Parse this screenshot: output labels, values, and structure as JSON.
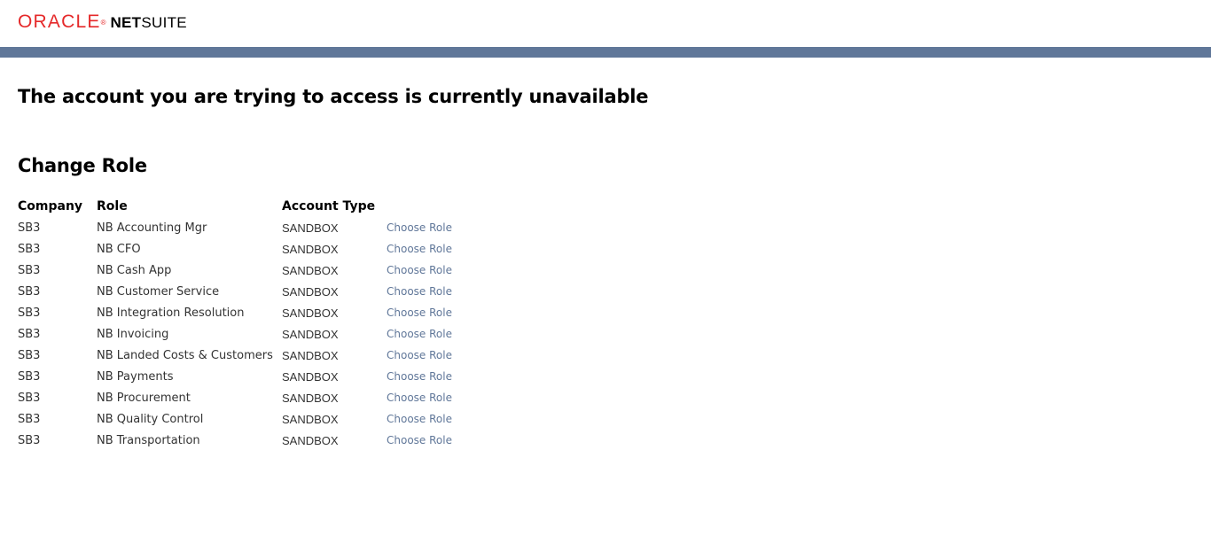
{
  "brand": {
    "oracle": "ORACLE",
    "registered": "®",
    "net": "NET",
    "suite": "SUITE",
    "oracle_color": "#e5292a",
    "band_color": "#607799"
  },
  "message": "The account you are trying to access is currently unavailable",
  "change_role": {
    "title": "Change Role",
    "columns": {
      "company": "Company",
      "role": "Role",
      "account_type": "Account Type"
    },
    "link_color": "#607799",
    "rows": [
      {
        "company": "SB3",
        "role": "NB Accounting Mgr",
        "account_type": "SANDBOX",
        "action": "Choose Role"
      },
      {
        "company": "SB3",
        "role": "NB CFO",
        "account_type": "SANDBOX",
        "action": "Choose Role"
      },
      {
        "company": "SB3",
        "role": "NB Cash App",
        "account_type": "SANDBOX",
        "action": "Choose Role"
      },
      {
        "company": "SB3",
        "role": "NB Customer Service",
        "account_type": "SANDBOX",
        "action": "Choose Role"
      },
      {
        "company": "SB3",
        "role": "NB Integration Resolution",
        "account_type": "SANDBOX",
        "action": "Choose Role"
      },
      {
        "company": "SB3",
        "role": "NB Invoicing",
        "account_type": "SANDBOX",
        "action": "Choose Role"
      },
      {
        "company": "SB3",
        "role": "NB Landed Costs & Customers",
        "account_type": "SANDBOX",
        "action": "Choose Role"
      },
      {
        "company": "SB3",
        "role": "NB Payments",
        "account_type": "SANDBOX",
        "action": "Choose Role"
      },
      {
        "company": "SB3",
        "role": "NB Procurement",
        "account_type": "SANDBOX",
        "action": "Choose Role"
      },
      {
        "company": "SB3",
        "role": "NB Quality Control",
        "account_type": "SANDBOX",
        "action": "Choose Role"
      },
      {
        "company": "SB3",
        "role": "NB Transportation",
        "account_type": "SANDBOX",
        "action": "Choose Role"
      }
    ]
  }
}
